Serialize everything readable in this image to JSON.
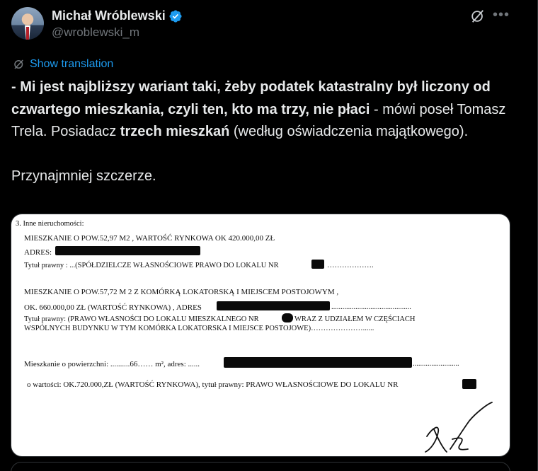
{
  "author": {
    "name": "Michał Wróblewski",
    "handle": "@wroblewski_m"
  },
  "translate": {
    "label": "Show translation"
  },
  "tweet": {
    "p1_bold1": "- Mi jest najbliższy wariant taki, żeby podatek katastralny był liczony od czwartego mieszkania, czyli ten, kto ma trzy, nie płaci",
    "p1_rest1": " - mówi poseł Tomasz Trela. Posiadacz ",
    "p1_bold2": "trzech mieszkań",
    "p1_rest2": " (według oświadczenia majątkowego).",
    "p2": "Przynajmniej szczerze."
  },
  "document": {
    "heading": "3. Inne nieruchomości:",
    "l1": "MIESZKANIE  O POW.52,97 M2 , WARTOŚĆ RYNKOWA OK 420.000,00 ZŁ",
    "l2": "ADRES:",
    "l3a": "Tytuł prawny : ...(SPÓŁDZIELCZE WŁASNOŚCIOWE PRAWO DO LOKALU NR",
    "l3b": "……………….",
    "l4": "MIESZKANIE O POW.57,72 M 2 Z KOMÓRKĄ LOKATORSKĄ I MIEJSCEM POSTOJOWYM ,",
    "l5a": "OK. 660.000,00 ZŁ (WARTOŚĆ RYNKOWA) , ADRES",
    "l5b": "...........................................",
    "l6a": "Tytuł prawny: (PRAWO WŁASNOŚCI DO LOKALU MIESZKALNEGO NR",
    "l6b": "WRAZ Z UDZIAŁEM W CZĘŚCIACH",
    "l7": "WSPÓLNYCH BUDYNKU W TYM KOMÓRKA LOKATORSKA I MIEJSCE POSTOJOWE)…………………......",
    "l8a": "Mieszkanie o powierzchni: ..........66…… m², adres: ......",
    "l8b": ".........................",
    "l9": "o wartości: OK.720.000,ZŁ  (WARTOŚĆ RYNKOWA),  tytuł prawny: PRAWO WŁASNOŚCIOWE DO LOKALU NR"
  },
  "colors": {
    "accent": "#1d9bf0",
    "text": "#e7e9ea",
    "muted": "#71767b",
    "background": "#000000"
  },
  "icons": {
    "verified": "verified-badge-icon",
    "grok": "grok-icon",
    "more": "more-icon",
    "translate": "translate-icon"
  }
}
